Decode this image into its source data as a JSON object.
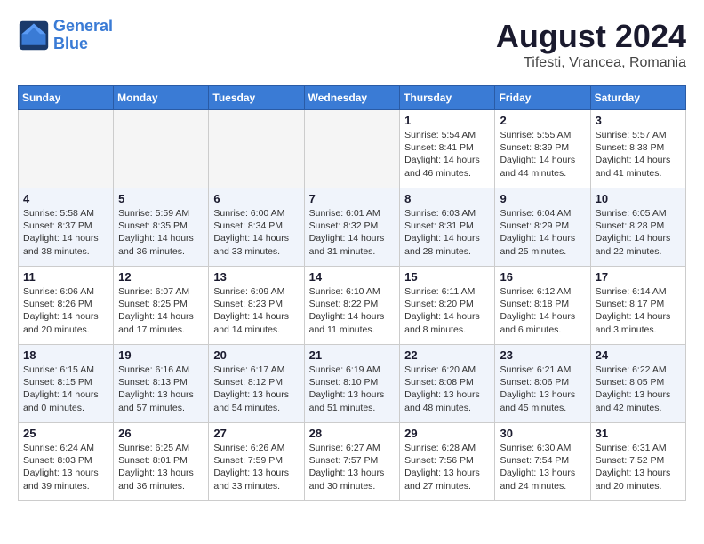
{
  "header": {
    "logo_line1": "General",
    "logo_line2": "Blue",
    "title": "August 2024",
    "subtitle": "Tifesti, Vrancea, Romania"
  },
  "weekdays": [
    "Sunday",
    "Monday",
    "Tuesday",
    "Wednesday",
    "Thursday",
    "Friday",
    "Saturday"
  ],
  "weeks": [
    [
      {
        "day": "",
        "info": ""
      },
      {
        "day": "",
        "info": ""
      },
      {
        "day": "",
        "info": ""
      },
      {
        "day": "",
        "info": ""
      },
      {
        "day": "1",
        "info": "Sunrise: 5:54 AM\nSunset: 8:41 PM\nDaylight: 14 hours\nand 46 minutes."
      },
      {
        "day": "2",
        "info": "Sunrise: 5:55 AM\nSunset: 8:39 PM\nDaylight: 14 hours\nand 44 minutes."
      },
      {
        "day": "3",
        "info": "Sunrise: 5:57 AM\nSunset: 8:38 PM\nDaylight: 14 hours\nand 41 minutes."
      }
    ],
    [
      {
        "day": "4",
        "info": "Sunrise: 5:58 AM\nSunset: 8:37 PM\nDaylight: 14 hours\nand 38 minutes."
      },
      {
        "day": "5",
        "info": "Sunrise: 5:59 AM\nSunset: 8:35 PM\nDaylight: 14 hours\nand 36 minutes."
      },
      {
        "day": "6",
        "info": "Sunrise: 6:00 AM\nSunset: 8:34 PM\nDaylight: 14 hours\nand 33 minutes."
      },
      {
        "day": "7",
        "info": "Sunrise: 6:01 AM\nSunset: 8:32 PM\nDaylight: 14 hours\nand 31 minutes."
      },
      {
        "day": "8",
        "info": "Sunrise: 6:03 AM\nSunset: 8:31 PM\nDaylight: 14 hours\nand 28 minutes."
      },
      {
        "day": "9",
        "info": "Sunrise: 6:04 AM\nSunset: 8:29 PM\nDaylight: 14 hours\nand 25 minutes."
      },
      {
        "day": "10",
        "info": "Sunrise: 6:05 AM\nSunset: 8:28 PM\nDaylight: 14 hours\nand 22 minutes."
      }
    ],
    [
      {
        "day": "11",
        "info": "Sunrise: 6:06 AM\nSunset: 8:26 PM\nDaylight: 14 hours\nand 20 minutes."
      },
      {
        "day": "12",
        "info": "Sunrise: 6:07 AM\nSunset: 8:25 PM\nDaylight: 14 hours\nand 17 minutes."
      },
      {
        "day": "13",
        "info": "Sunrise: 6:09 AM\nSunset: 8:23 PM\nDaylight: 14 hours\nand 14 minutes."
      },
      {
        "day": "14",
        "info": "Sunrise: 6:10 AM\nSunset: 8:22 PM\nDaylight: 14 hours\nand 11 minutes."
      },
      {
        "day": "15",
        "info": "Sunrise: 6:11 AM\nSunset: 8:20 PM\nDaylight: 14 hours\nand 8 minutes."
      },
      {
        "day": "16",
        "info": "Sunrise: 6:12 AM\nSunset: 8:18 PM\nDaylight: 14 hours\nand 6 minutes."
      },
      {
        "day": "17",
        "info": "Sunrise: 6:14 AM\nSunset: 8:17 PM\nDaylight: 14 hours\nand 3 minutes."
      }
    ],
    [
      {
        "day": "18",
        "info": "Sunrise: 6:15 AM\nSunset: 8:15 PM\nDaylight: 14 hours\nand 0 minutes."
      },
      {
        "day": "19",
        "info": "Sunrise: 6:16 AM\nSunset: 8:13 PM\nDaylight: 13 hours\nand 57 minutes."
      },
      {
        "day": "20",
        "info": "Sunrise: 6:17 AM\nSunset: 8:12 PM\nDaylight: 13 hours\nand 54 minutes."
      },
      {
        "day": "21",
        "info": "Sunrise: 6:19 AM\nSunset: 8:10 PM\nDaylight: 13 hours\nand 51 minutes."
      },
      {
        "day": "22",
        "info": "Sunrise: 6:20 AM\nSunset: 8:08 PM\nDaylight: 13 hours\nand 48 minutes."
      },
      {
        "day": "23",
        "info": "Sunrise: 6:21 AM\nSunset: 8:06 PM\nDaylight: 13 hours\nand 45 minutes."
      },
      {
        "day": "24",
        "info": "Sunrise: 6:22 AM\nSunset: 8:05 PM\nDaylight: 13 hours\nand 42 minutes."
      }
    ],
    [
      {
        "day": "25",
        "info": "Sunrise: 6:24 AM\nSunset: 8:03 PM\nDaylight: 13 hours\nand 39 minutes."
      },
      {
        "day": "26",
        "info": "Sunrise: 6:25 AM\nSunset: 8:01 PM\nDaylight: 13 hours\nand 36 minutes."
      },
      {
        "day": "27",
        "info": "Sunrise: 6:26 AM\nSunset: 7:59 PM\nDaylight: 13 hours\nand 33 minutes."
      },
      {
        "day": "28",
        "info": "Sunrise: 6:27 AM\nSunset: 7:57 PM\nDaylight: 13 hours\nand 30 minutes."
      },
      {
        "day": "29",
        "info": "Sunrise: 6:28 AM\nSunset: 7:56 PM\nDaylight: 13 hours\nand 27 minutes."
      },
      {
        "day": "30",
        "info": "Sunrise: 6:30 AM\nSunset: 7:54 PM\nDaylight: 13 hours\nand 24 minutes."
      },
      {
        "day": "31",
        "info": "Sunrise: 6:31 AM\nSunset: 7:52 PM\nDaylight: 13 hours\nand 20 minutes."
      }
    ]
  ]
}
